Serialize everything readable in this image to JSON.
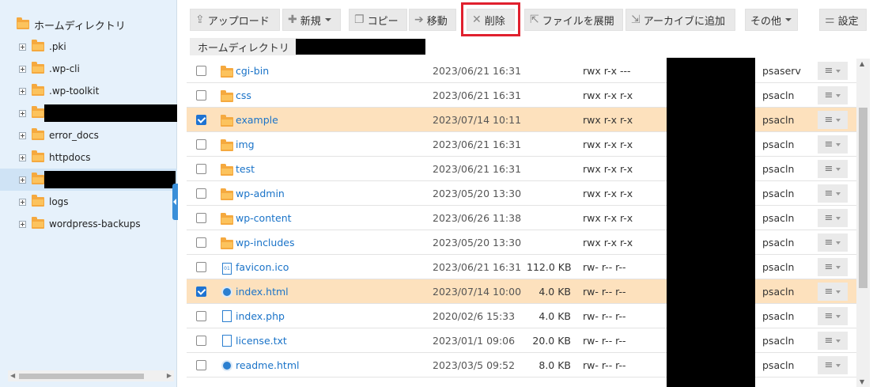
{
  "sidebar": {
    "root_label": "ホームディレクトリ",
    "items": [
      {
        "label": ".pki"
      },
      {
        "label": ".wp-cli"
      },
      {
        "label": ".wp-toolkit"
      },
      {
        "label": ""
      },
      {
        "label": "error_docs"
      },
      {
        "label": "httpdocs"
      },
      {
        "label": ""
      },
      {
        "label": "logs"
      },
      {
        "label": "wordpress-backups"
      }
    ]
  },
  "toolbar": {
    "upload": "アップロード",
    "new": "新規",
    "copy": "コピー",
    "move": "移動",
    "delete": "削除",
    "extract": "ファイルを展開",
    "archive": "アーカイブに追加",
    "other": "その他",
    "settings": "設定"
  },
  "breadcrumb": {
    "home": "ホームディレクトリ"
  },
  "files": [
    {
      "name": "cgi-bin",
      "type": "folder",
      "date": "2023/06/21 16:31",
      "size": "",
      "perm": "rwx r-x ---",
      "owner": "psaserv",
      "selected": false
    },
    {
      "name": "css",
      "type": "folder",
      "date": "2023/06/21 16:31",
      "size": "",
      "perm": "rwx r-x r-x",
      "owner": "psacln",
      "selected": false
    },
    {
      "name": "example",
      "type": "folder",
      "date": "2023/07/14 10:11",
      "size": "",
      "perm": "rwx r-x r-x",
      "owner": "psacln",
      "selected": true
    },
    {
      "name": "img",
      "type": "folder",
      "date": "2023/06/21 16:31",
      "size": "",
      "perm": "rwx r-x r-x",
      "owner": "psacln",
      "selected": false
    },
    {
      "name": "test",
      "type": "folder",
      "date": "2023/06/21 16:31",
      "size": "",
      "perm": "rwx r-x r-x",
      "owner": "psacln",
      "selected": false
    },
    {
      "name": "wp-admin",
      "type": "folder",
      "date": "2023/05/20 13:30",
      "size": "",
      "perm": "rwx r-x r-x",
      "owner": "psacln",
      "selected": false
    },
    {
      "name": "wp-content",
      "type": "folder",
      "date": "2023/06/26 11:38",
      "size": "",
      "perm": "rwx r-x r-x",
      "owner": "psacln",
      "selected": false
    },
    {
      "name": "wp-includes",
      "type": "folder",
      "date": "2023/05/20 13:30",
      "size": "",
      "perm": "rwx r-x r-x",
      "owner": "psacln",
      "selected": false
    },
    {
      "name": "favicon.ico",
      "type": "binary",
      "date": "2023/06/21 16:31",
      "size": "112.0 KB",
      "perm": "rw- r-- r--",
      "owner": "psacln",
      "selected": false
    },
    {
      "name": "index.html",
      "type": "html",
      "date": "2023/07/14 10:00",
      "size": "4.0 KB",
      "perm": "rw- r-- r--",
      "owner": "psacln",
      "selected": true
    },
    {
      "name": "index.php",
      "type": "doc",
      "date": "2020/02/6 15:33",
      "size": "4.0 KB",
      "perm": "rw- r-- r--",
      "owner": "psacln",
      "selected": false
    },
    {
      "name": "license.txt",
      "type": "doc",
      "date": "2023/01/1 09:06",
      "size": "20.0 KB",
      "perm": "rw- r-- r--",
      "owner": "psacln",
      "selected": false
    },
    {
      "name": "readme.html",
      "type": "html",
      "date": "2023/03/5 09:52",
      "size": "8.0 KB",
      "perm": "rw- r-- r--",
      "owner": "psacln",
      "selected": false
    }
  ],
  "icons": {
    "binary_glyph": "01",
    "menu_glyph": "≡"
  },
  "colors": {
    "selected_row": "#fde1bd",
    "link": "#1a73c8",
    "highlight_border": "#e0202e",
    "sidebar_bg": "#e6f1fb"
  }
}
